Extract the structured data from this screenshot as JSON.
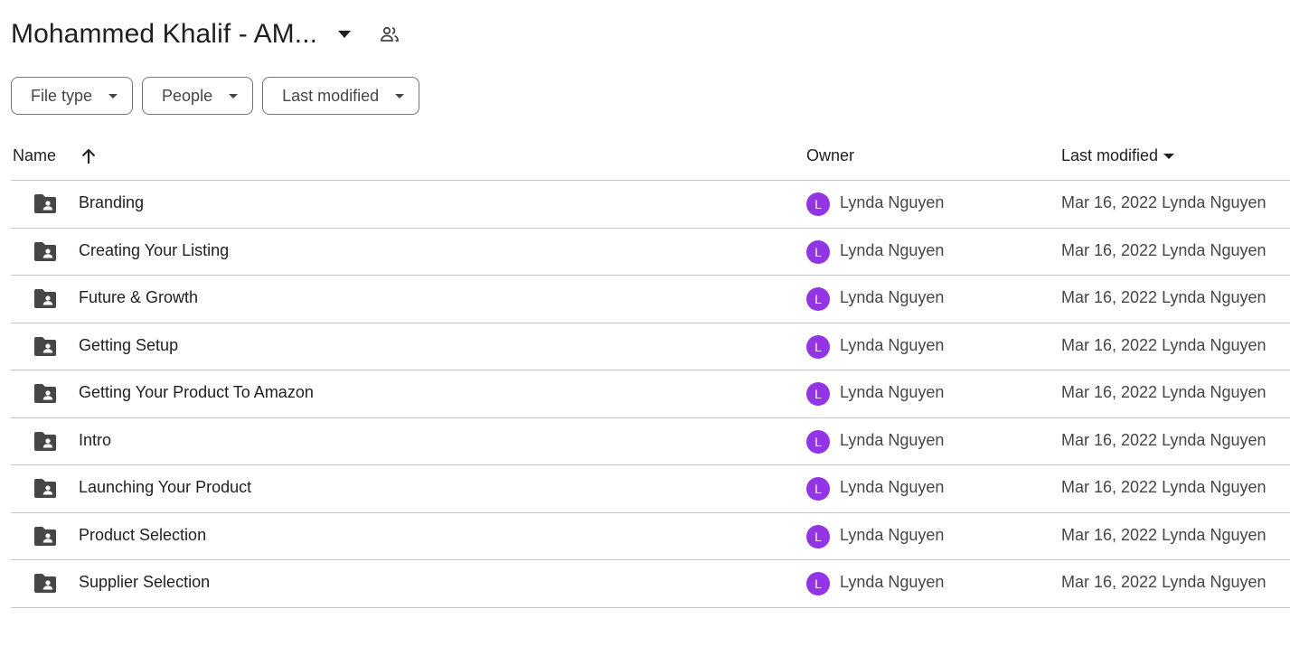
{
  "header": {
    "title": "Mohammed Khalif - AM...",
    "title_menu_icon": "arrow-drop-down-icon",
    "shared_icon": "people-icon"
  },
  "filters": [
    {
      "label": "File type"
    },
    {
      "label": "People"
    },
    {
      "label": "Last modified"
    }
  ],
  "table": {
    "columns": {
      "name": "Name",
      "owner": "Owner",
      "last_modified": "Last modified"
    },
    "sort": {
      "column": "name",
      "direction": "ascending"
    },
    "rows": [
      {
        "name": "Branding",
        "owner_initial": "L",
        "owner": "Lynda Nguyen",
        "modified": "Mar 16, 2022 Lynda Nguyen"
      },
      {
        "name": "Creating Your Listing",
        "owner_initial": "L",
        "owner": "Lynda Nguyen",
        "modified": "Mar 16, 2022 Lynda Nguyen"
      },
      {
        "name": "Future & Growth",
        "owner_initial": "L",
        "owner": "Lynda Nguyen",
        "modified": "Mar 16, 2022 Lynda Nguyen"
      },
      {
        "name": "Getting Setup",
        "owner_initial": "L",
        "owner": "Lynda Nguyen",
        "modified": "Mar 16, 2022 Lynda Nguyen"
      },
      {
        "name": "Getting Your Product To Amazon",
        "owner_initial": "L",
        "owner": "Lynda Nguyen",
        "modified": "Mar 16, 2022 Lynda Nguyen"
      },
      {
        "name": "Intro",
        "owner_initial": "L",
        "owner": "Lynda Nguyen",
        "modified": "Mar 16, 2022 Lynda Nguyen"
      },
      {
        "name": "Launching Your Product",
        "owner_initial": "L",
        "owner": "Lynda Nguyen",
        "modified": "Mar 16, 2022 Lynda Nguyen"
      },
      {
        "name": "Product Selection",
        "owner_initial": "L",
        "owner": "Lynda Nguyen",
        "modified": "Mar 16, 2022 Lynda Nguyen"
      },
      {
        "name": "Supplier Selection",
        "owner_initial": "L",
        "owner": "Lynda Nguyen",
        "modified": "Mar 16, 2022 Lynda Nguyen"
      }
    ]
  },
  "colors": {
    "avatar": "#9334e6",
    "folder_icon": "#444746",
    "divider": "#c4c7c5"
  }
}
